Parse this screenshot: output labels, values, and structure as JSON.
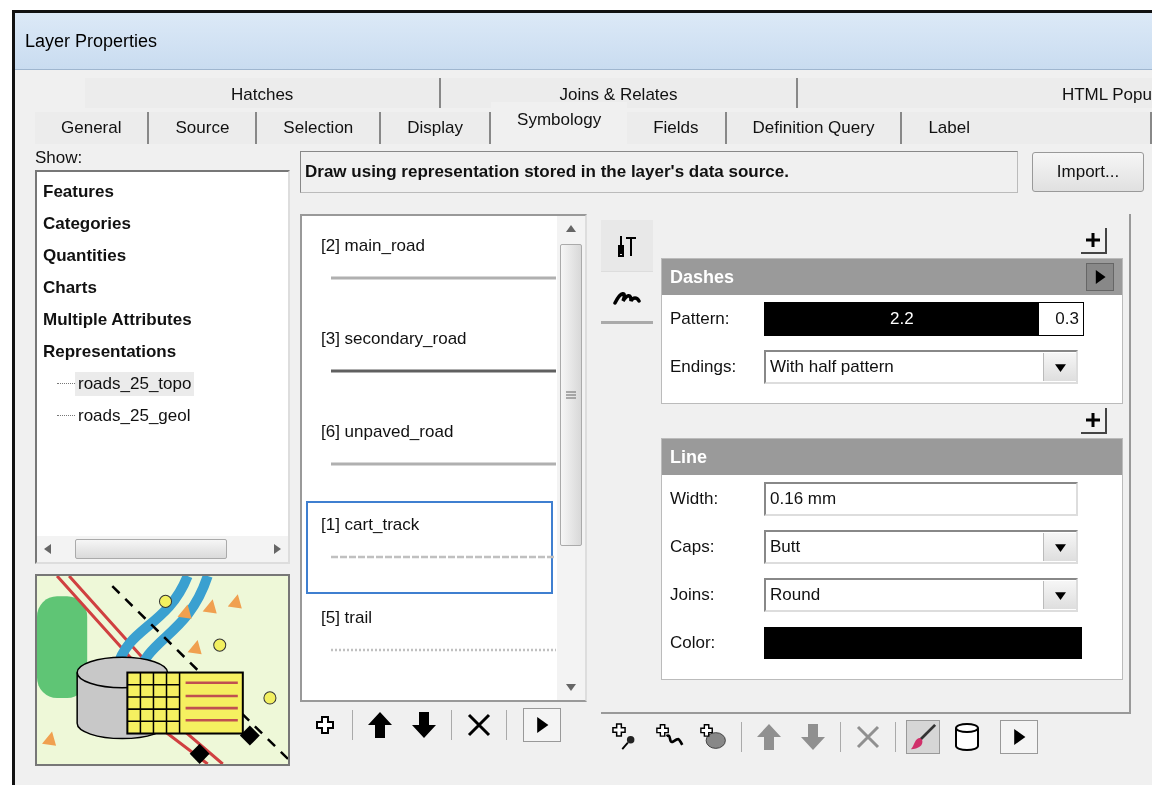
{
  "window": {
    "title": "Layer Properties"
  },
  "tabs": {
    "back_row": [
      {
        "label": "Hatches"
      },
      {
        "label": "Joins & Relates"
      },
      {
        "label": "HTML Popu"
      }
    ],
    "front_row": [
      {
        "label": "General",
        "selected": false
      },
      {
        "label": "Source",
        "selected": false
      },
      {
        "label": "Selection",
        "selected": false
      },
      {
        "label": "Display",
        "selected": false
      },
      {
        "label": "Symbology",
        "selected": true
      },
      {
        "label": "Fields",
        "selected": false
      },
      {
        "label": "Definition Query",
        "selected": false
      },
      {
        "label": "Label",
        "selected": false
      }
    ]
  },
  "show": {
    "label": "Show:",
    "items": [
      {
        "label": "Features"
      },
      {
        "label": "Categories"
      },
      {
        "label": "Quantities"
      },
      {
        "label": "Charts"
      },
      {
        "label": "Multiple Attributes"
      },
      {
        "label": "Representations",
        "children": [
          {
            "label": "roads_25_topo",
            "selected": true
          },
          {
            "label": "roads_25_geol",
            "selected": false
          }
        ]
      }
    ]
  },
  "description": "Draw using representation stored in the layer's data source.",
  "import_button": "Import...",
  "rules": [
    {
      "label": "[2] main_road",
      "kind": "solid",
      "color": "#b0b0b0",
      "selected": false
    },
    {
      "label": "[3] secondary_road",
      "kind": "solid",
      "color": "#606060",
      "selected": false
    },
    {
      "label": "[6] unpaved_road",
      "kind": "solid",
      "color": "#b0b0b0",
      "selected": false
    },
    {
      "label": "[1] cart_track",
      "kind": "dashed",
      "color": "#c0c0c0",
      "selected": true
    },
    {
      "label": "[5] trail",
      "kind": "dotted",
      "color": "#c0c0c0",
      "selected": false
    }
  ],
  "rule_toolbar": [
    {
      "kind": "add"
    },
    {
      "kind": "sep"
    },
    {
      "kind": "up"
    },
    {
      "kind": "down"
    },
    {
      "kind": "sep"
    },
    {
      "kind": "delete"
    },
    {
      "kind": "sep"
    },
    {
      "kind": "more"
    }
  ],
  "side_tabs": [
    {
      "kind": "tools",
      "selected": false
    },
    {
      "kind": "stroke",
      "selected": true
    }
  ],
  "dashes": {
    "title": "Dashes",
    "pattern_label": "Pattern:",
    "pattern": [
      {
        "kind": "dash",
        "value": "2.2"
      },
      {
        "kind": "gap",
        "value": "0.3"
      }
    ],
    "endings_label": "Endings:",
    "endings": "With half pattern"
  },
  "line": {
    "title": "Line",
    "width_label": "Width:",
    "width": "0.16 mm",
    "caps_label": "Caps:",
    "caps": "Butt",
    "joins_label": "Joins:",
    "joins": "Round",
    "color_label": "Color:",
    "color": "#000000"
  },
  "layer_toolbar": [
    {
      "kind": "add-marker",
      "disabled": false,
      "pressed": false
    },
    {
      "kind": "add-stroke",
      "disabled": false,
      "pressed": false
    },
    {
      "kind": "add-fill",
      "disabled": false,
      "pressed": false
    },
    {
      "kind": "sep"
    },
    {
      "kind": "up",
      "disabled": true,
      "pressed": false
    },
    {
      "kind": "down",
      "disabled": true,
      "pressed": false
    },
    {
      "kind": "sep"
    },
    {
      "kind": "delete",
      "disabled": true,
      "pressed": false
    },
    {
      "kind": "sep"
    },
    {
      "kind": "brush",
      "disabled": false,
      "pressed": true
    },
    {
      "kind": "cylinder",
      "disabled": false,
      "pressed": false
    },
    {
      "kind": "more"
    }
  ]
}
